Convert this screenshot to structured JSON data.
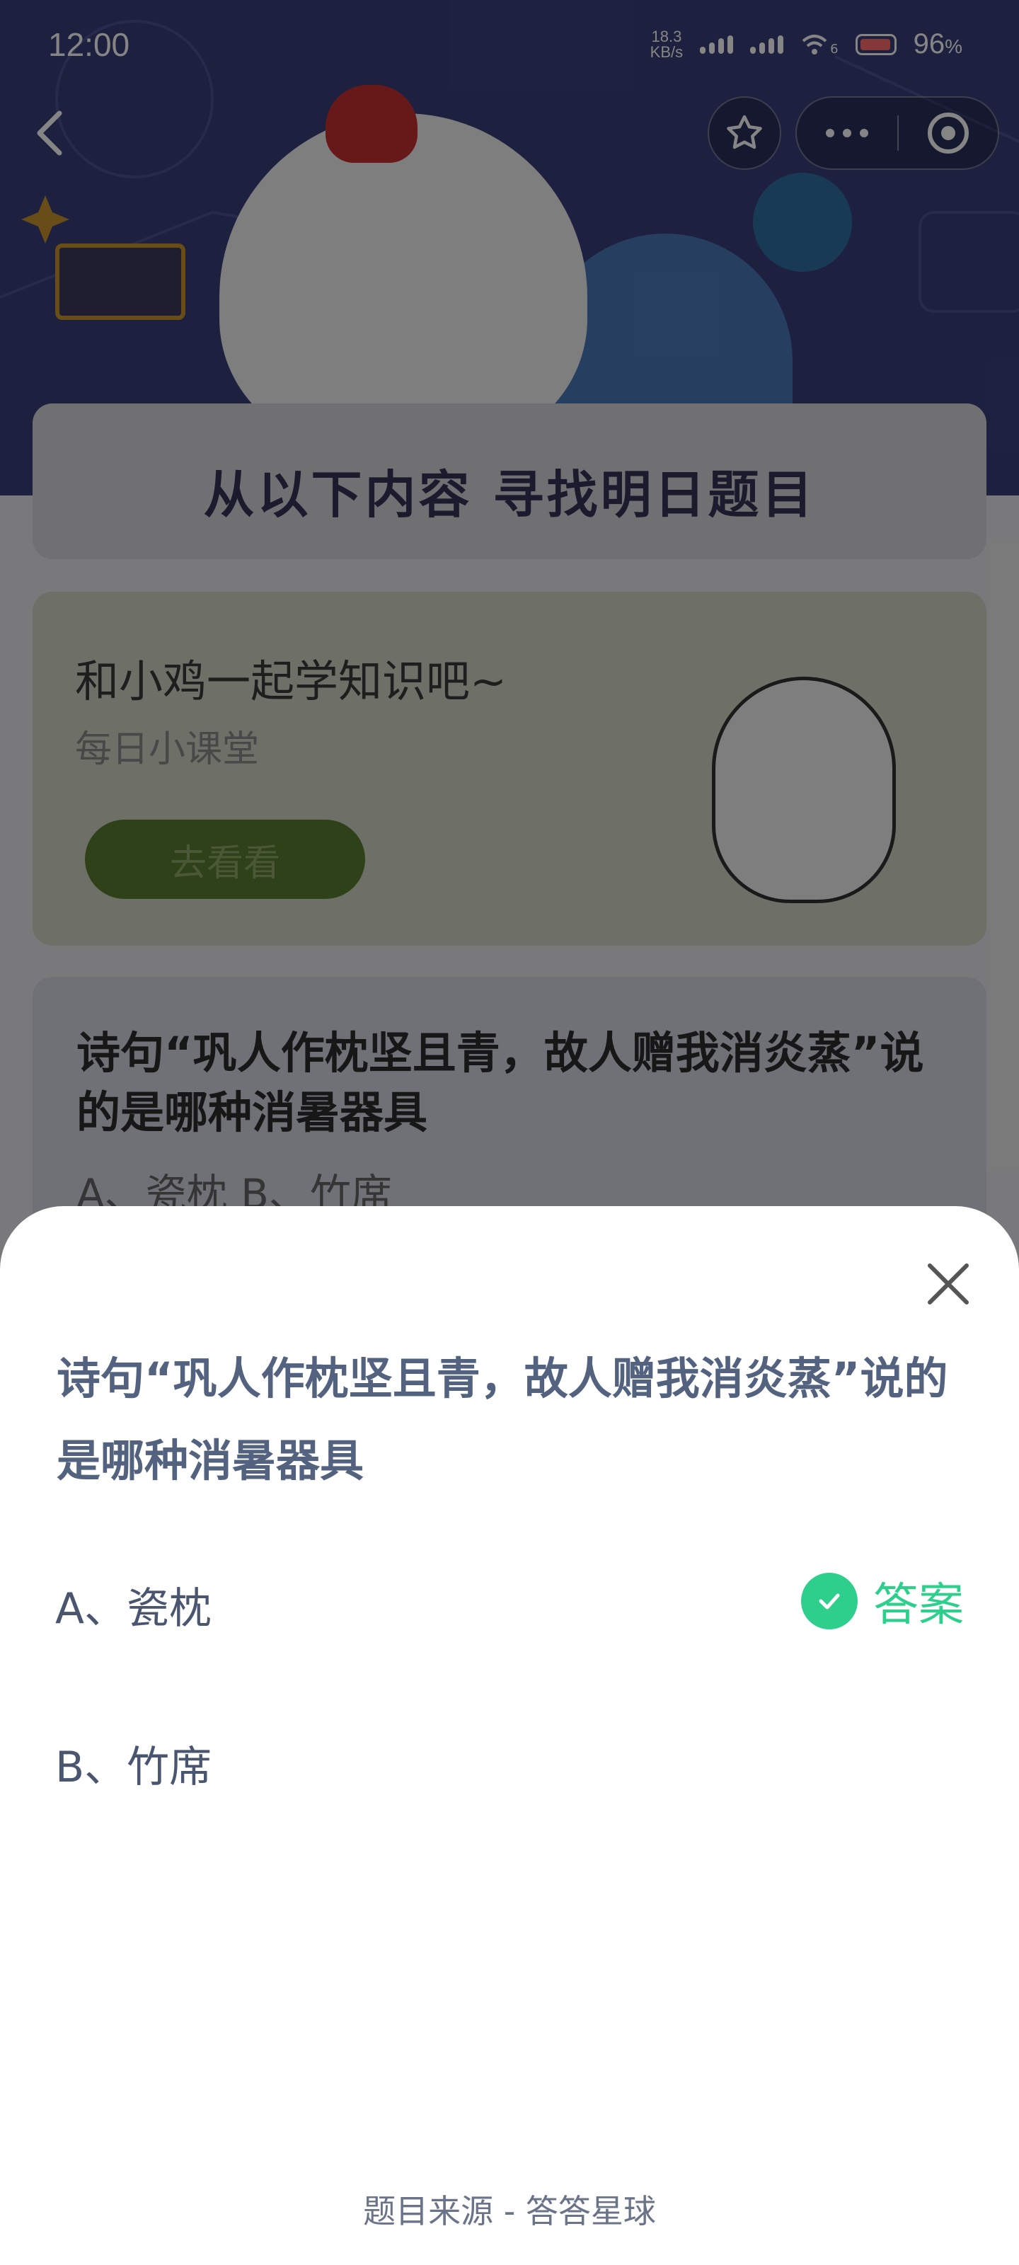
{
  "status_bar": {
    "time": "12:00",
    "net_speed_value": "18.3",
    "net_speed_unit": "KB/s",
    "signal_extra": "6",
    "battery": "96",
    "battery_unit": "%"
  },
  "header": {
    "banner_title": "从以下内容  寻找明日题目"
  },
  "card_course": {
    "title": "和小鸡一起学知识吧~",
    "subtitle": "每日小课堂",
    "button": "去看看"
  },
  "card_question": {
    "question": "诗句“巩人作枕坚且青，故人赠我消炎蒸”说的是哪种消暑器具",
    "options_preview": "A、瓷枕    B、竹席"
  },
  "sheet": {
    "question": "诗句“巩人作枕坚且青，故人赠我消炎蒸”说的是哪种消暑器具",
    "option_a": "A、瓷枕",
    "option_b": "B、竹席",
    "answer_label": "答案",
    "source": "题目来源 - 答答星球"
  },
  "colors": {
    "accent_green": "#2ecf8d",
    "question_text": "#53637f",
    "hero_bg": "#3a3f7a"
  },
  "icons": [
    "back-arrow-icon",
    "star-icon",
    "more-dots-icon",
    "target-icon",
    "close-icon",
    "check-circle-icon"
  ]
}
